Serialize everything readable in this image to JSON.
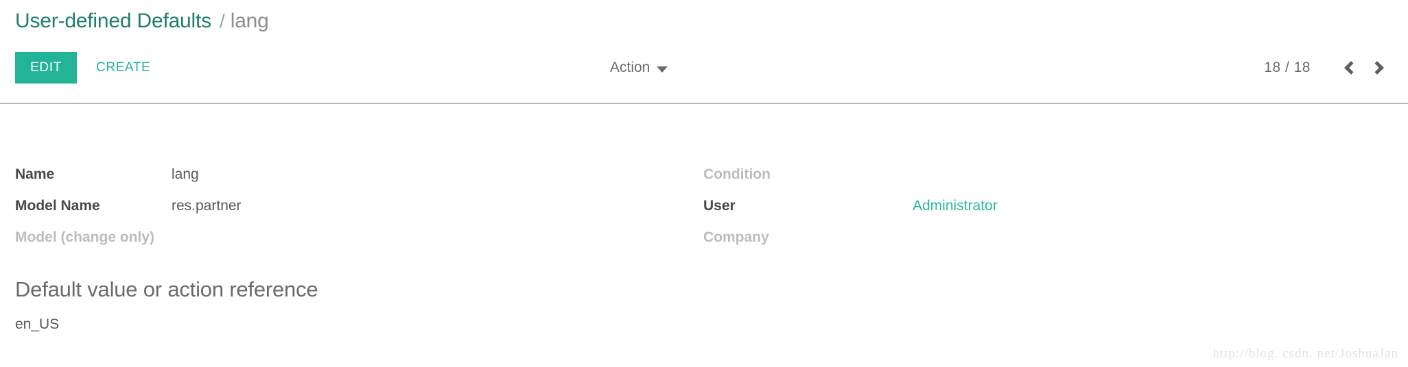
{
  "breadcrumb": {
    "root": "User-defined Defaults",
    "separator": "/",
    "current": "lang"
  },
  "toolbar": {
    "edit_label": "EDIT",
    "create_label": "CREATE",
    "action_label": "Action",
    "action_caret_icon": "caret-down-icon",
    "pager_count": "18 / 18",
    "prev_icon": "chevron-left-icon",
    "next_icon": "chevron-right-icon"
  },
  "form": {
    "left_column": [
      {
        "label": "Name",
        "value": "lang",
        "label_muted": false,
        "value_link": false
      },
      {
        "label": "Model Name",
        "value": "res.partner",
        "label_muted": false,
        "value_link": false
      },
      {
        "label": "Model (change only)",
        "value": "",
        "label_muted": true,
        "value_link": false
      }
    ],
    "right_column": [
      {
        "label": "Condition",
        "value": "",
        "label_muted": true,
        "value_link": false
      },
      {
        "label": "User",
        "value": "Administrator",
        "label_muted": false,
        "value_link": true
      },
      {
        "label": "Company",
        "value": "",
        "label_muted": true,
        "value_link": false
      }
    ]
  },
  "section": {
    "title": "Default value or action reference",
    "value": "en_US"
  },
  "watermark": {
    "text": "http://blog. csdn. net/JoshuaJan"
  },
  "colors": {
    "brand_green": "#23b396",
    "breadcrumb_green": "#1f7f6b",
    "link_green": "#29b89a",
    "text_gray": "#55595c",
    "muted_gray": "#bcbcbc",
    "divider_gray": "#b6b6b6"
  }
}
